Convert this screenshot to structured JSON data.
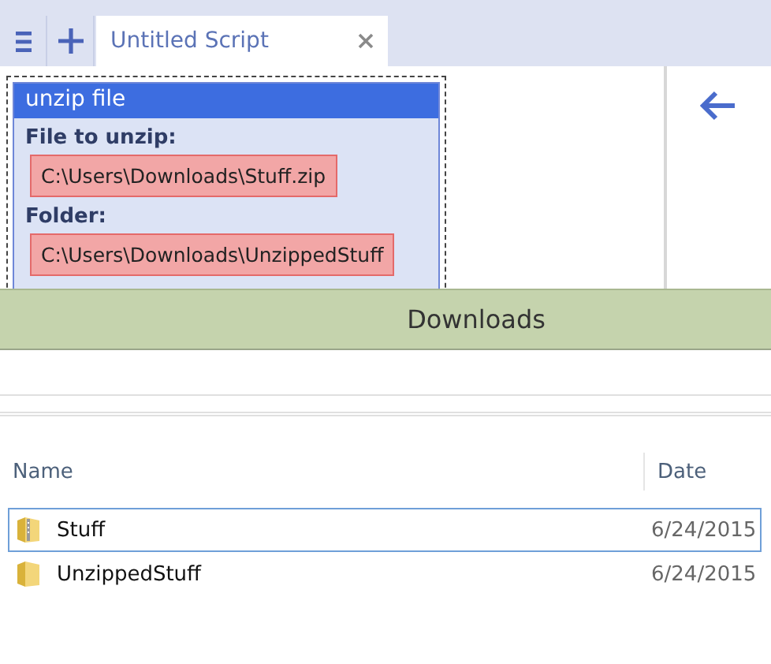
{
  "editor_tabs": [
    {
      "label": "Untitled Script",
      "selected": true
    }
  ],
  "script_block": {
    "title": "unzip file",
    "params": [
      {
        "label": "File to unzip:",
        "value": "C:\\Users\\Downloads\\Stuff.zip"
      },
      {
        "label": "Folder:",
        "value": "C:\\Users\\Downloads\\UnzippedStuff"
      }
    ]
  },
  "explorer": {
    "title": "Downloads",
    "columns": [
      "Name",
      "Date"
    ],
    "rows": [
      {
        "name": "Stuff",
        "kind": "zip",
        "date": "6/24/2015",
        "selected": true
      },
      {
        "name": "UnzippedStuff",
        "kind": "folder",
        "date": "6/24/2015",
        "selected": false
      }
    ]
  }
}
